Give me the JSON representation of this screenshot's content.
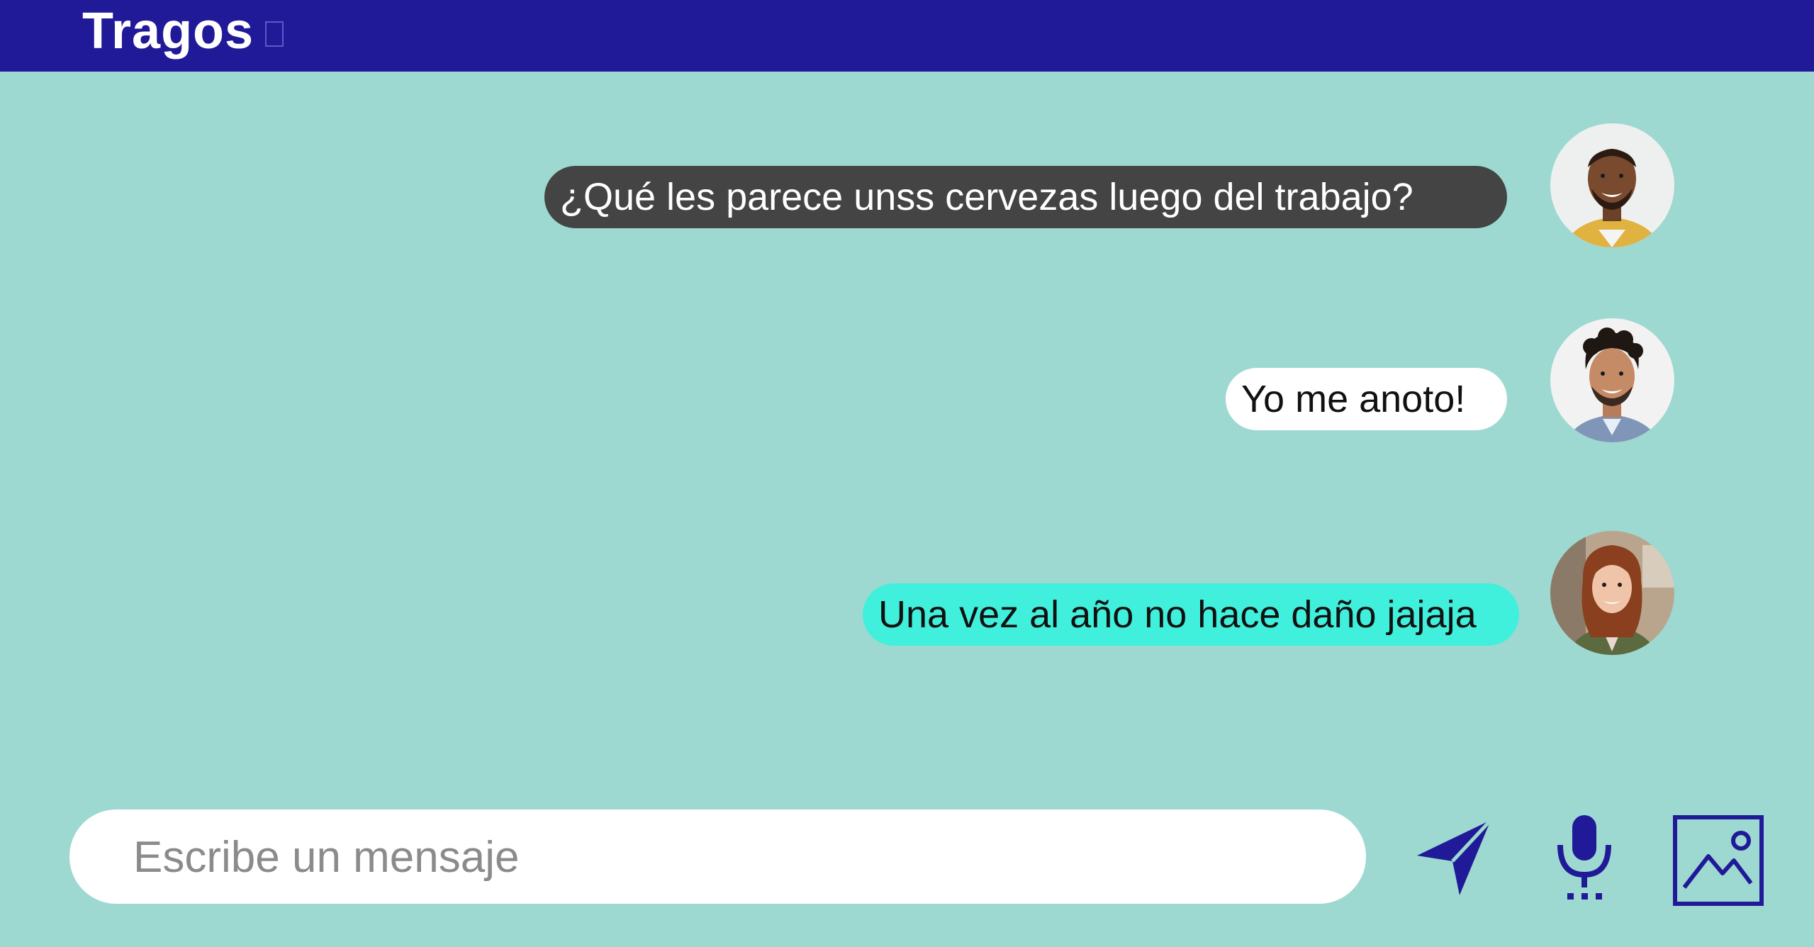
{
  "header": {
    "title": "Tragos"
  },
  "messages": [
    {
      "text": "¿Qué les parece unss cervezas luego del trabajo?",
      "bubble_color": "#444444",
      "text_color": "#ffffff",
      "avatar": "smiling-man-bald-beard-avatar"
    },
    {
      "text": "Yo me anoto!",
      "bubble_color": "#ffffff",
      "text_color": "#111111",
      "avatar": "smiling-man-curly-hair-avatar"
    },
    {
      "text": "Una vez al año no hace daño jajaja",
      "bubble_color": "#40f0dc",
      "text_color": "#111111",
      "avatar": "smiling-woman-red-hair-avatar"
    }
  ],
  "composer": {
    "placeholder": "Escribe un mensaje"
  },
  "actions": {
    "send_icon": "send-icon",
    "mic_icon": "microphone-icon",
    "image_icon": "image-icon"
  },
  "colors": {
    "header": "#211a98",
    "background": "#9dd9d0",
    "accent": "#211a98"
  }
}
